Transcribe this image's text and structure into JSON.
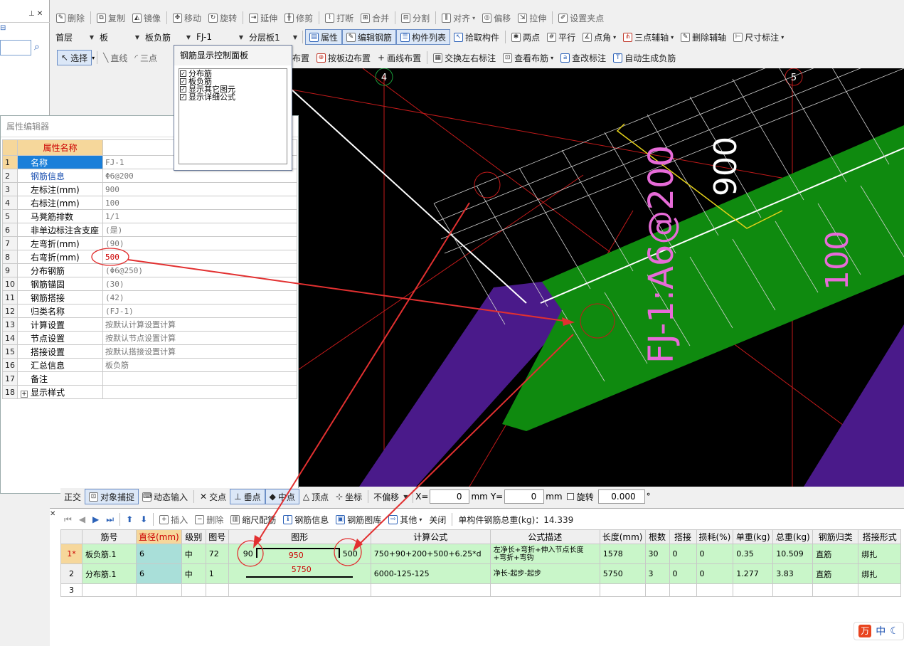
{
  "toolbar1": {
    "items": [
      "删除",
      "复制",
      "镜像",
      "移动",
      "旋转",
      "延伸",
      "修剪",
      "打断",
      "合并",
      "分割",
      "对齐",
      "偏移",
      "拉伸",
      "设置夹点"
    ]
  },
  "toolbar2": {
    "floor": "首层",
    "category": "板",
    "type": "板负筋",
    "component": "FJ-1",
    "layer": "分层板1",
    "items": [
      "属性",
      "编辑钢筋",
      "构件列表",
      "拾取构件",
      "两点",
      "平行",
      "点角",
      "三点辅轴",
      "删除辅轴",
      "尺寸标注"
    ]
  },
  "toolbar3": {
    "items": [
      "选择",
      "直线",
      "三点",
      "按墙布置",
      "按板边布置",
      "画线布置",
      "交换左右标注",
      "查看布筋",
      "查改标注",
      "自动生成负筋"
    ]
  },
  "control_panel": {
    "title": "钢筋显示控制面板",
    "items": [
      "分布筋",
      "板负筋",
      "显示其它图元",
      "显示详细公式"
    ]
  },
  "property_editor": {
    "title": "属性编辑器",
    "header": "属性名称",
    "rows": [
      {
        "n": "1",
        "name": "名称",
        "value": "FJ-1"
      },
      {
        "n": "2",
        "name": "钢筋信息",
        "value": "Φ6@200"
      },
      {
        "n": "3",
        "name": "左标注(mm)",
        "value": "900"
      },
      {
        "n": "4",
        "name": "右标注(mm)",
        "value": "100"
      },
      {
        "n": "5",
        "name": "马凳筋排数",
        "value": "1/1"
      },
      {
        "n": "6",
        "name": "非单边标注含支座",
        "value": "(是)"
      },
      {
        "n": "7",
        "name": "左弯折(mm)",
        "value": "(90)"
      },
      {
        "n": "8",
        "name": "右弯折(mm)",
        "value": "500"
      },
      {
        "n": "9",
        "name": "分布钢筋",
        "value": "(Φ6@250)"
      },
      {
        "n": "10",
        "name": "钢筋锚固",
        "value": "(30)"
      },
      {
        "n": "11",
        "name": "钢筋搭接",
        "value": "(42)"
      },
      {
        "n": "12",
        "name": "归类名称",
        "value": "(FJ-1)"
      },
      {
        "n": "13",
        "name": "计算设置",
        "value": "按默认计算设置计算"
      },
      {
        "n": "14",
        "name": "节点设置",
        "value": "按默认节点设置计算"
      },
      {
        "n": "15",
        "name": "搭接设置",
        "value": "按默认搭接设置计算"
      },
      {
        "n": "16",
        "name": "汇总信息",
        "value": "板负筋"
      },
      {
        "n": "17",
        "name": "备注",
        "value": ""
      },
      {
        "n": "18",
        "name": "显示样式",
        "value": ""
      }
    ]
  },
  "viewport": {
    "axis_left": "4",
    "axis_right": "5",
    "annot_main": "FJ-1:A6@200",
    "annot_left": "900",
    "annot_right": "100"
  },
  "snap_toolbar": {
    "items": [
      "正交",
      "对象捕捉",
      "动态输入",
      "交点",
      "垂点",
      "中点",
      "顶点",
      "坐标",
      "不偏移"
    ],
    "x_label": "X=",
    "x_value": "0",
    "y_label": "Y=",
    "y_value": "0",
    "unit": "mm",
    "rotate_label": "旋转",
    "rotate_value": "0.000",
    "degree": "°"
  },
  "grid_toolbar": {
    "items": [
      "插入",
      "删除",
      "缩尺配筋",
      "钢筋信息",
      "钢筋图库",
      "其他",
      "关闭"
    ],
    "total": "单构件钢筋总重(kg)：14.339"
  },
  "rebar_table": {
    "headers": [
      "",
      "筋号",
      "直径(mm)",
      "级别",
      "图号",
      "图形",
      "计算公式",
      "公式描述",
      "长度(mm)",
      "根数",
      "搭接",
      "损耗(%)",
      "单重(kg)",
      "总重(kg)",
      "钢筋归类",
      "搭接形式"
    ],
    "rows": [
      {
        "rn": "1*",
        "name": "板负筋.1",
        "dia": "6",
        "grade": "中",
        "fig": "72",
        "shape_l": "90",
        "shape_m": "950",
        "shape_r": "500",
        "formula": "750+90+200+500+6.25*d",
        "desc": "左净长+弯折+伸入节点长度+弯折+弯钩",
        "len": "1578",
        "count": "30",
        "lap": "0",
        "loss": "0",
        "unit_w": "0.35",
        "total_w": "10.509",
        "cat": "直筋",
        "lap_type": "绑扎"
      },
      {
        "rn": "2",
        "name": "分布筋.1",
        "dia": "6",
        "grade": "中",
        "fig": "1",
        "shape_l": "",
        "shape_m": "5750",
        "shape_r": "",
        "formula": "6000-125-125",
        "desc": "净长-起步-起步",
        "len": "5750",
        "count": "3",
        "lap": "0",
        "loss": "0",
        "unit_w": "1.277",
        "total_w": "3.83",
        "cat": "直筋",
        "lap_type": "绑扎"
      },
      {
        "rn": "3"
      }
    ]
  },
  "ime": {
    "label": "中"
  }
}
